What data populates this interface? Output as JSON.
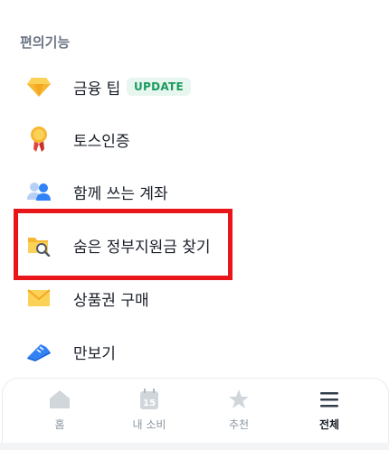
{
  "section": {
    "title": "편의기능"
  },
  "menu": [
    {
      "label": "금융 팁",
      "badge": "UPDATE",
      "icon": "diamond-icon"
    },
    {
      "label": "토스인증",
      "icon": "medal-icon"
    },
    {
      "label": "함께 쓰는 계좌",
      "icon": "people-icon"
    },
    {
      "label": "숨은 정부지원금 찾기",
      "icon": "folder-search-icon"
    },
    {
      "label": "상품권 구매",
      "icon": "envelope-icon"
    },
    {
      "label": "만보기",
      "icon": "sneaker-icon"
    }
  ],
  "tabs": [
    {
      "label": "홈",
      "icon": "home-icon"
    },
    {
      "label": "내 소비",
      "icon": "calendar-icon",
      "date": "15"
    },
    {
      "label": "추천",
      "icon": "star-icon"
    },
    {
      "label": "전체",
      "icon": "menu-icon",
      "active": true
    }
  ],
  "colors": {
    "highlight": "#e8161b",
    "badge_bg": "#e7f6ee",
    "badge_text": "#1c9b5e",
    "accent_blue": "#3182f6"
  }
}
